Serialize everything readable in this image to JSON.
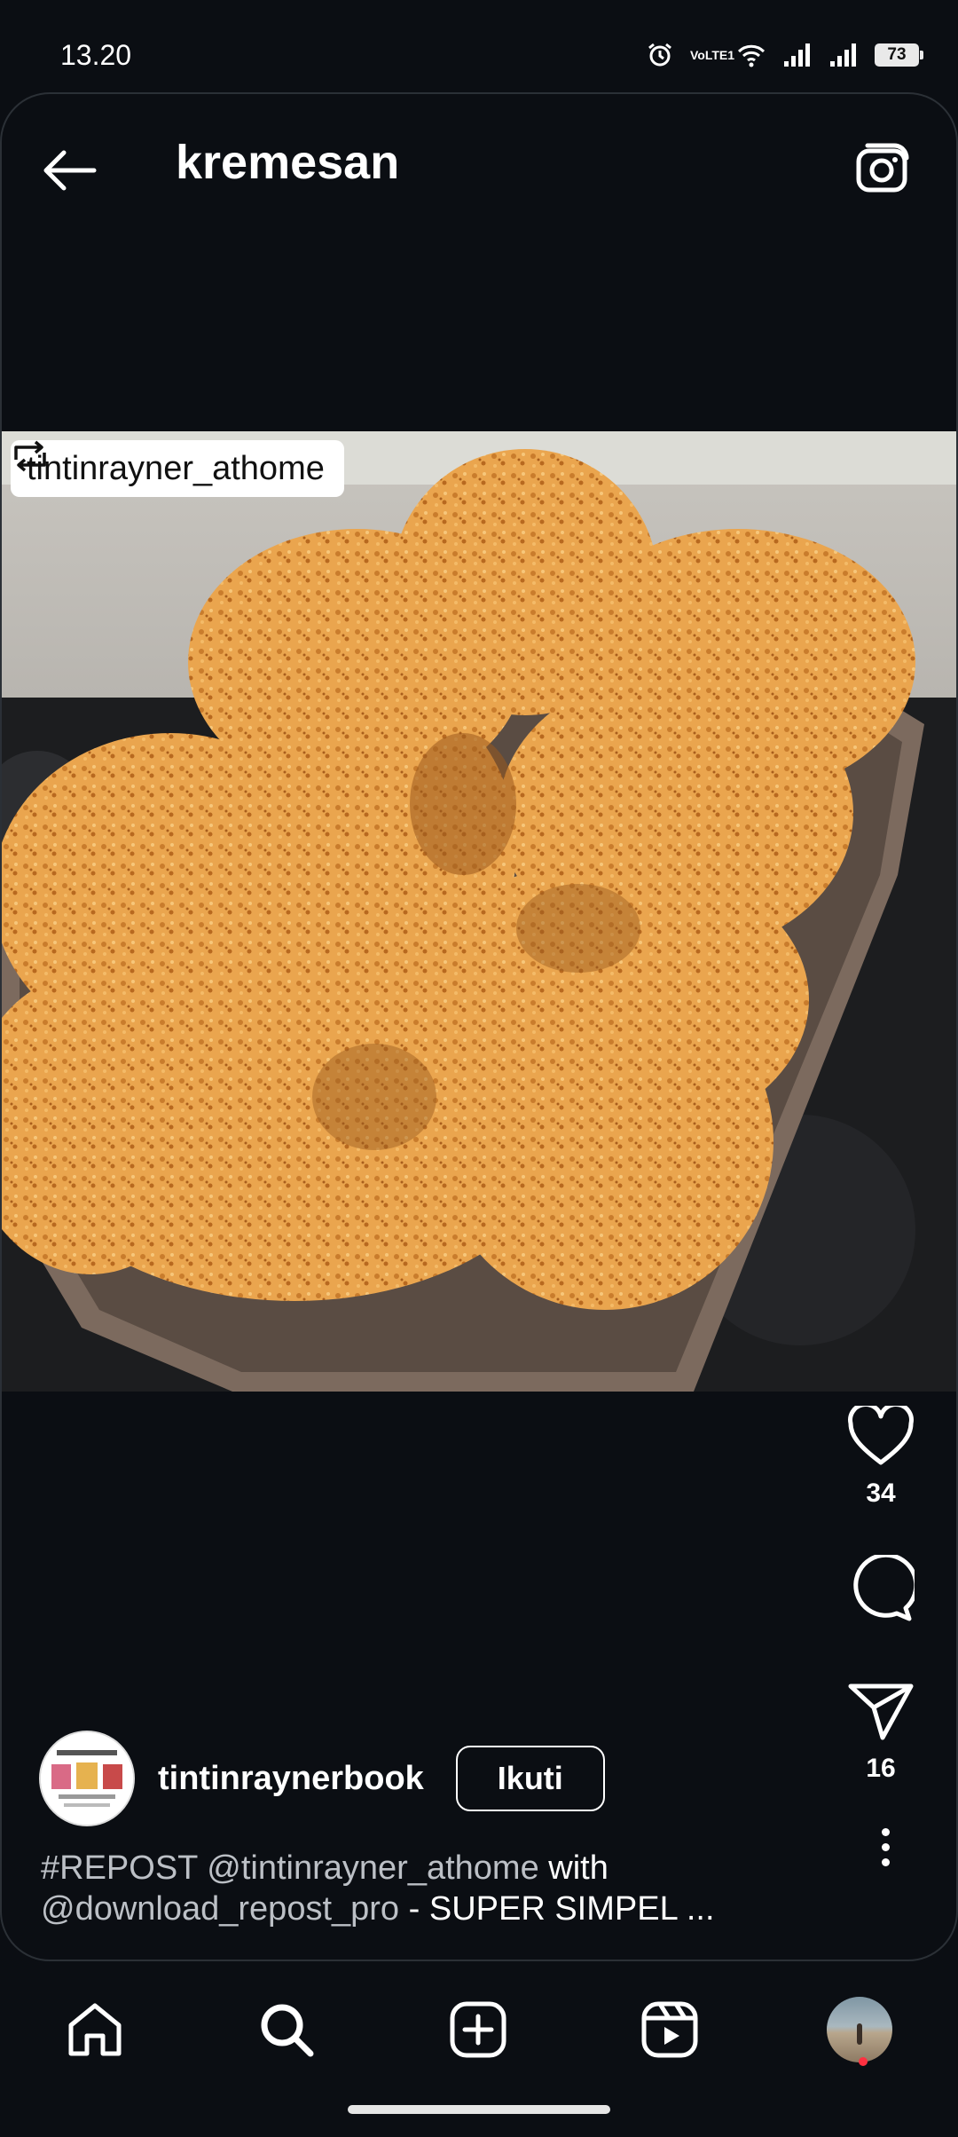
{
  "status_bar": {
    "time": "13.20",
    "network_label": "VoLTE1",
    "battery": "73"
  },
  "header": {
    "title": "kremesan",
    "back_icon": "arrow-left-icon",
    "camera_icon": "camera-icon"
  },
  "post": {
    "repost_badge": "tintinrayner_athome",
    "repost_icon": "repost-icon",
    "likes": "34",
    "shares": "16",
    "author": "tintinraynerbook",
    "follow_label": "Ikuti",
    "caption_parts": {
      "hashtag": "#REPOST",
      "mention1": "@tintinrayner_athome",
      "with": " with ",
      "mention2": "@download_repost_pro",
      "text": " - SUPER SIMPEL ..."
    }
  },
  "bottom_nav": {
    "items": [
      "home-icon",
      "search-icon",
      "add-icon",
      "reels-icon",
      "profile-avatar"
    ]
  },
  "colors": {
    "background": "#0b0e13",
    "text": "#ffffff",
    "muted": "#bcc0c6",
    "notification_dot": "#ff3040",
    "food": "#e9a24a"
  }
}
